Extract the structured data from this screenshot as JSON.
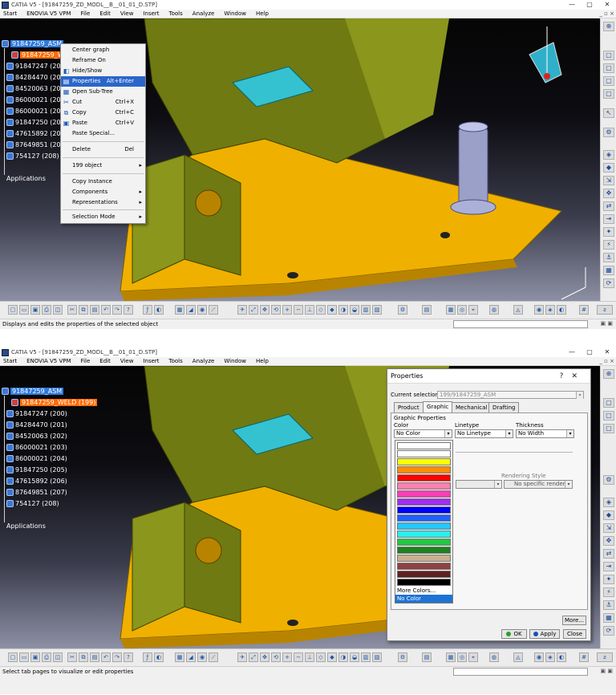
{
  "app": {
    "title": "CATIA V5 - [91847259_ZD_MODL__B__01_01_D.STP]",
    "win_min": "—",
    "win_max": "▢",
    "win_close": "✕",
    "mdi_ctrls": "_ ▫ ×"
  },
  "menu": [
    "Start",
    "ENOVIA V5 VPM",
    "File",
    "Edit",
    "View",
    "Insert",
    "Tools",
    "Analyze",
    "Window",
    "Help"
  ],
  "tree": {
    "root": "91847259_ASM",
    "selected": "91847259_WELD (199)",
    "items": [
      "91847247 (200)",
      "84284470 (201)",
      "84520063 (202)",
      "86000021 (203)",
      "86000021 (204)",
      "91847250 (205)",
      "47615892 (206)",
      "87649851 (207)",
      "754127 (208)"
    ],
    "applications": "Applications"
  },
  "tree_trunc": {
    "items": [
      "91847247 (20",
      "84284470 (20",
      "84520063 (20",
      "86000021 (20",
      "86000021 (20",
      "91847250 (20",
      "47615892 (20",
      "87649851 (20",
      "754127 (208)"
    ]
  },
  "context_menu": {
    "center_graph": "Center graph",
    "reframe_on": "Reframe On",
    "hide_show": "Hide/Show",
    "properties": "Properties",
    "properties_sc": "Alt+Enter",
    "open_subtree": "Open Sub-Tree",
    "cut": "Cut",
    "cut_sc": "Ctrl+X",
    "copy": "Copy",
    "copy_sc": "Ctrl+C",
    "paste": "Paste",
    "paste_sc": "Ctrl+V",
    "paste_special": "Paste Special...",
    "delete": "Delete",
    "delete_sc": "Del",
    "object": "199 object",
    "copy_instance": "Copy Instance",
    "components": "Components",
    "representations": "Representations",
    "selection_mode": "Selection Mode"
  },
  "status": {
    "top": "Displays and edits the properties of the selected object",
    "bottom": "Select tab pages to visualize or edit properties",
    "right_btns": "▣ ▣"
  },
  "dialog": {
    "title": "Properties",
    "help": "?",
    "close": "✕",
    "current_selection_label": "Current selection :",
    "current_selection_value": "199/91847259_ASM",
    "tabs": [
      "Product",
      "Graphic",
      "Mechanical",
      "Drafting"
    ],
    "group_label": "Graphic Properties",
    "color_label": "Color",
    "color_value": "No Color",
    "linetype_label": "Linetype",
    "linetype_value": "No Linetype",
    "thickness_label": "Thickness",
    "thickness_value": "No Width",
    "rendering_label": "Rendering Style",
    "rendering_value": "No specific renderin",
    "more_btn": "More...",
    "ok_btn": "OK",
    "apply_btn": "Apply",
    "close_btn": "Close"
  },
  "color_list": {
    "swatches": [
      "#ffffff",
      "#ffffff",
      "#ffff00",
      "#ff8c00",
      "#ff0000",
      "#ff7fb0",
      "#ff3cb4",
      "#a02cf0",
      "#0000ff",
      "#2060ff",
      "#22c8ff",
      "#28f0f0",
      "#22c840",
      "#208020",
      "#c8b090",
      "#904040",
      "#602020",
      "#000000"
    ],
    "more_colors": "More Colors...",
    "no_color": "No Color"
  },
  "colors": {
    "model_yellow": "#f0b000",
    "model_olive": "#6f7a12",
    "cyan_part": "#35c2d0",
    "highlight": "#2a66c9",
    "tree_selected": "#ff6a00"
  }
}
